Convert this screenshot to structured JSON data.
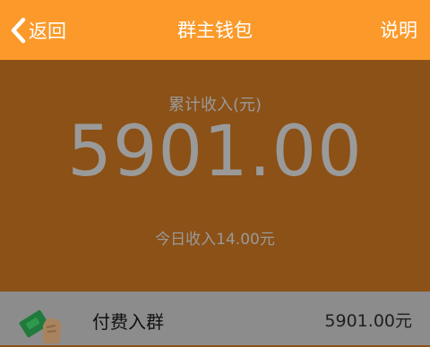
{
  "header": {
    "back_label": "返回",
    "title": "群主钱包",
    "explain_label": "说明"
  },
  "summary": {
    "cumulative_label": "累计收入(元)",
    "cumulative_value": "5901.00",
    "today_label": "今日收入14.00元"
  },
  "records": [
    {
      "icon": "money-in-hand-icon",
      "label": "付费入群",
      "amount": "5901.00元"
    }
  ],
  "colors": {
    "header": "#fb9a2a",
    "overlay": "#8b5117",
    "row": "#8c8c8c"
  }
}
